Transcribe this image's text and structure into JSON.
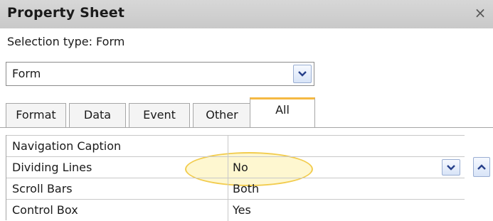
{
  "window": {
    "title": "Property Sheet",
    "close_glyph": "×"
  },
  "selection": {
    "label": "Selection type:  Form"
  },
  "object_combo": {
    "value": "Form",
    "icon": "chevron-down-icon"
  },
  "tabs": [
    {
      "label": "Format",
      "active": false
    },
    {
      "label": "Data",
      "active": false
    },
    {
      "label": "Event",
      "active": false
    },
    {
      "label": "Other",
      "active": false
    },
    {
      "label": "All",
      "active": true
    }
  ],
  "properties": [
    {
      "name": "Navigation Caption",
      "value": ""
    },
    {
      "name": "Dividing Lines",
      "value": "No",
      "has_dropdown": true,
      "highlighted": true
    },
    {
      "name": "Scroll Bars",
      "value": "Both"
    },
    {
      "name": "Control Box",
      "value": "Yes"
    }
  ],
  "colors": {
    "title_bar": "#cfcfcf",
    "active_tab_accent": "#f5b942",
    "highlight": "#fdf0aa",
    "button_border": "#9aaed2"
  }
}
